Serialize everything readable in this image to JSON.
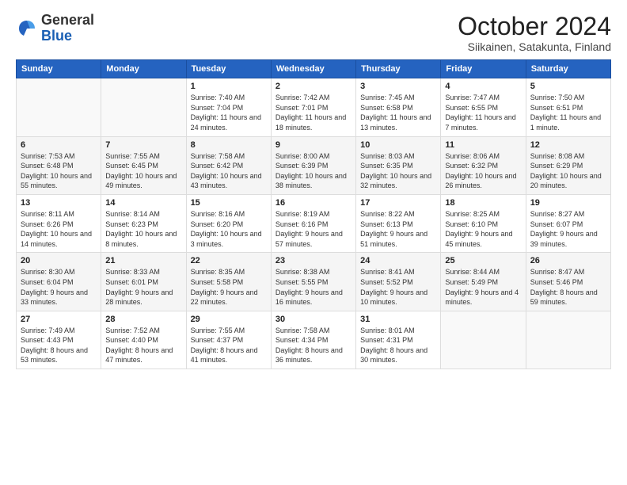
{
  "logo": {
    "general": "General",
    "blue": "Blue"
  },
  "header": {
    "month": "October 2024",
    "location": "Siikainen, Satakunta, Finland"
  },
  "weekdays": [
    "Sunday",
    "Monday",
    "Tuesday",
    "Wednesday",
    "Thursday",
    "Friday",
    "Saturday"
  ],
  "weeks": [
    [
      {
        "day": "",
        "sunrise": "",
        "sunset": "",
        "daylight": ""
      },
      {
        "day": "",
        "sunrise": "",
        "sunset": "",
        "daylight": ""
      },
      {
        "day": "1",
        "sunrise": "Sunrise: 7:40 AM",
        "sunset": "Sunset: 7:04 PM",
        "daylight": "Daylight: 11 hours and 24 minutes."
      },
      {
        "day": "2",
        "sunrise": "Sunrise: 7:42 AM",
        "sunset": "Sunset: 7:01 PM",
        "daylight": "Daylight: 11 hours and 18 minutes."
      },
      {
        "day": "3",
        "sunrise": "Sunrise: 7:45 AM",
        "sunset": "Sunset: 6:58 PM",
        "daylight": "Daylight: 11 hours and 13 minutes."
      },
      {
        "day": "4",
        "sunrise": "Sunrise: 7:47 AM",
        "sunset": "Sunset: 6:55 PM",
        "daylight": "Daylight: 11 hours and 7 minutes."
      },
      {
        "day": "5",
        "sunrise": "Sunrise: 7:50 AM",
        "sunset": "Sunset: 6:51 PM",
        "daylight": "Daylight: 11 hours and 1 minute."
      }
    ],
    [
      {
        "day": "6",
        "sunrise": "Sunrise: 7:53 AM",
        "sunset": "Sunset: 6:48 PM",
        "daylight": "Daylight: 10 hours and 55 minutes."
      },
      {
        "day": "7",
        "sunrise": "Sunrise: 7:55 AM",
        "sunset": "Sunset: 6:45 PM",
        "daylight": "Daylight: 10 hours and 49 minutes."
      },
      {
        "day": "8",
        "sunrise": "Sunrise: 7:58 AM",
        "sunset": "Sunset: 6:42 PM",
        "daylight": "Daylight: 10 hours and 43 minutes."
      },
      {
        "day": "9",
        "sunrise": "Sunrise: 8:00 AM",
        "sunset": "Sunset: 6:39 PM",
        "daylight": "Daylight: 10 hours and 38 minutes."
      },
      {
        "day": "10",
        "sunrise": "Sunrise: 8:03 AM",
        "sunset": "Sunset: 6:35 PM",
        "daylight": "Daylight: 10 hours and 32 minutes."
      },
      {
        "day": "11",
        "sunrise": "Sunrise: 8:06 AM",
        "sunset": "Sunset: 6:32 PM",
        "daylight": "Daylight: 10 hours and 26 minutes."
      },
      {
        "day": "12",
        "sunrise": "Sunrise: 8:08 AM",
        "sunset": "Sunset: 6:29 PM",
        "daylight": "Daylight: 10 hours and 20 minutes."
      }
    ],
    [
      {
        "day": "13",
        "sunrise": "Sunrise: 8:11 AM",
        "sunset": "Sunset: 6:26 PM",
        "daylight": "Daylight: 10 hours and 14 minutes."
      },
      {
        "day": "14",
        "sunrise": "Sunrise: 8:14 AM",
        "sunset": "Sunset: 6:23 PM",
        "daylight": "Daylight: 10 hours and 8 minutes."
      },
      {
        "day": "15",
        "sunrise": "Sunrise: 8:16 AM",
        "sunset": "Sunset: 6:20 PM",
        "daylight": "Daylight: 10 hours and 3 minutes."
      },
      {
        "day": "16",
        "sunrise": "Sunrise: 8:19 AM",
        "sunset": "Sunset: 6:16 PM",
        "daylight": "Daylight: 9 hours and 57 minutes."
      },
      {
        "day": "17",
        "sunrise": "Sunrise: 8:22 AM",
        "sunset": "Sunset: 6:13 PM",
        "daylight": "Daylight: 9 hours and 51 minutes."
      },
      {
        "day": "18",
        "sunrise": "Sunrise: 8:25 AM",
        "sunset": "Sunset: 6:10 PM",
        "daylight": "Daylight: 9 hours and 45 minutes."
      },
      {
        "day": "19",
        "sunrise": "Sunrise: 8:27 AM",
        "sunset": "Sunset: 6:07 PM",
        "daylight": "Daylight: 9 hours and 39 minutes."
      }
    ],
    [
      {
        "day": "20",
        "sunrise": "Sunrise: 8:30 AM",
        "sunset": "Sunset: 6:04 PM",
        "daylight": "Daylight: 9 hours and 33 minutes."
      },
      {
        "day": "21",
        "sunrise": "Sunrise: 8:33 AM",
        "sunset": "Sunset: 6:01 PM",
        "daylight": "Daylight: 9 hours and 28 minutes."
      },
      {
        "day": "22",
        "sunrise": "Sunrise: 8:35 AM",
        "sunset": "Sunset: 5:58 PM",
        "daylight": "Daylight: 9 hours and 22 minutes."
      },
      {
        "day": "23",
        "sunrise": "Sunrise: 8:38 AM",
        "sunset": "Sunset: 5:55 PM",
        "daylight": "Daylight: 9 hours and 16 minutes."
      },
      {
        "day": "24",
        "sunrise": "Sunrise: 8:41 AM",
        "sunset": "Sunset: 5:52 PM",
        "daylight": "Daylight: 9 hours and 10 minutes."
      },
      {
        "day": "25",
        "sunrise": "Sunrise: 8:44 AM",
        "sunset": "Sunset: 5:49 PM",
        "daylight": "Daylight: 9 hours and 4 minutes."
      },
      {
        "day": "26",
        "sunrise": "Sunrise: 8:47 AM",
        "sunset": "Sunset: 5:46 PM",
        "daylight": "Daylight: 8 hours and 59 minutes."
      }
    ],
    [
      {
        "day": "27",
        "sunrise": "Sunrise: 7:49 AM",
        "sunset": "Sunset: 4:43 PM",
        "daylight": "Daylight: 8 hours and 53 minutes."
      },
      {
        "day": "28",
        "sunrise": "Sunrise: 7:52 AM",
        "sunset": "Sunset: 4:40 PM",
        "daylight": "Daylight: 8 hours and 47 minutes."
      },
      {
        "day": "29",
        "sunrise": "Sunrise: 7:55 AM",
        "sunset": "Sunset: 4:37 PM",
        "daylight": "Daylight: 8 hours and 41 minutes."
      },
      {
        "day": "30",
        "sunrise": "Sunrise: 7:58 AM",
        "sunset": "Sunset: 4:34 PM",
        "daylight": "Daylight: 8 hours and 36 minutes."
      },
      {
        "day": "31",
        "sunrise": "Sunrise: 8:01 AM",
        "sunset": "Sunset: 4:31 PM",
        "daylight": "Daylight: 8 hours and 30 minutes."
      },
      {
        "day": "",
        "sunrise": "",
        "sunset": "",
        "daylight": ""
      },
      {
        "day": "",
        "sunrise": "",
        "sunset": "",
        "daylight": ""
      }
    ]
  ]
}
